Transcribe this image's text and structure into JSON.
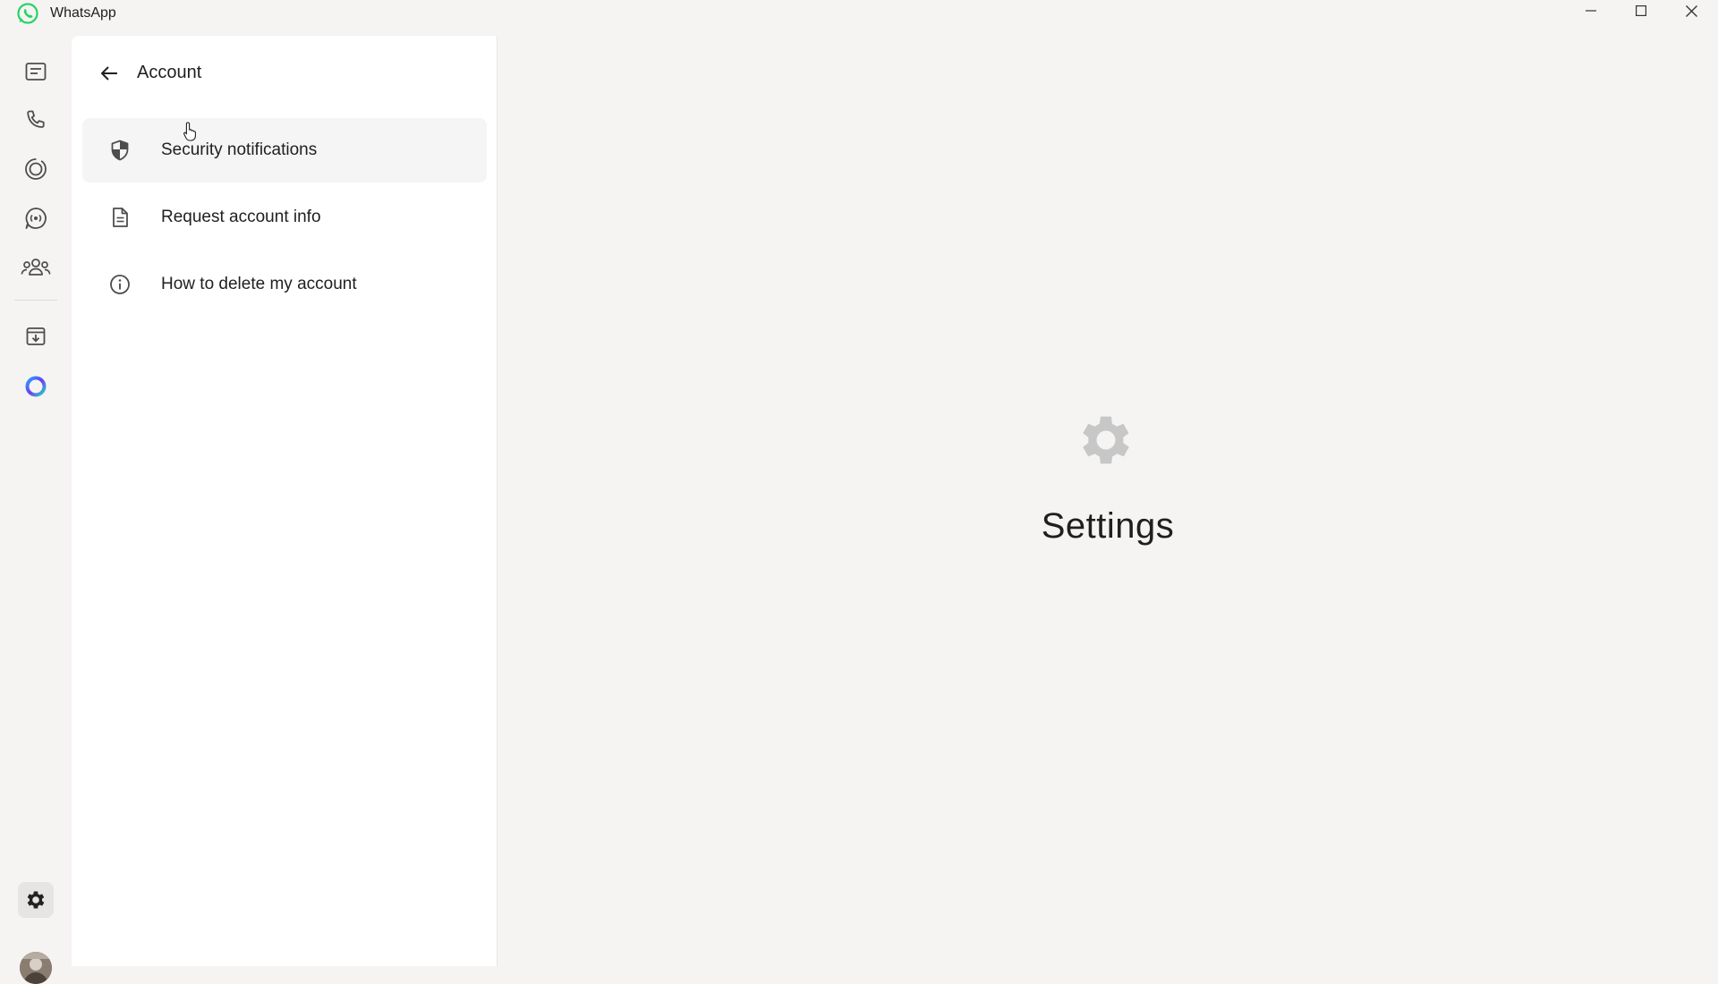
{
  "window": {
    "title": "WhatsApp",
    "controls": {
      "minimize": "minimize-icon",
      "maximize": "maximize-icon",
      "close": "close-icon"
    }
  },
  "rail": {
    "items": [
      {
        "name": "chats",
        "icon": "chats-icon"
      },
      {
        "name": "calls",
        "icon": "phone-icon"
      },
      {
        "name": "status",
        "icon": "status-icon"
      },
      {
        "name": "channels",
        "icon": "channels-icon"
      },
      {
        "name": "communities",
        "icon": "communities-icon"
      },
      {
        "name": "archived",
        "icon": "archive-icon"
      },
      {
        "name": "meta-ai",
        "icon": "meta-ai-icon"
      }
    ],
    "bottom": [
      {
        "name": "settings",
        "icon": "gear-icon",
        "active": true
      },
      {
        "name": "profile",
        "icon": "avatar"
      }
    ]
  },
  "panel": {
    "title": "Account",
    "items": [
      {
        "label": "Security notifications",
        "icon": "shield-icon",
        "hovered": true
      },
      {
        "label": "Request account info",
        "icon": "document-icon"
      },
      {
        "label": "How to delete my account",
        "icon": "info-icon"
      }
    ]
  },
  "main": {
    "placeholder_title": "Settings",
    "placeholder_icon": "gear-icon"
  },
  "colors": {
    "brand": "#25d366",
    "background": "#f5f4f3",
    "panel": "#ffffff",
    "icon": "#555555"
  }
}
